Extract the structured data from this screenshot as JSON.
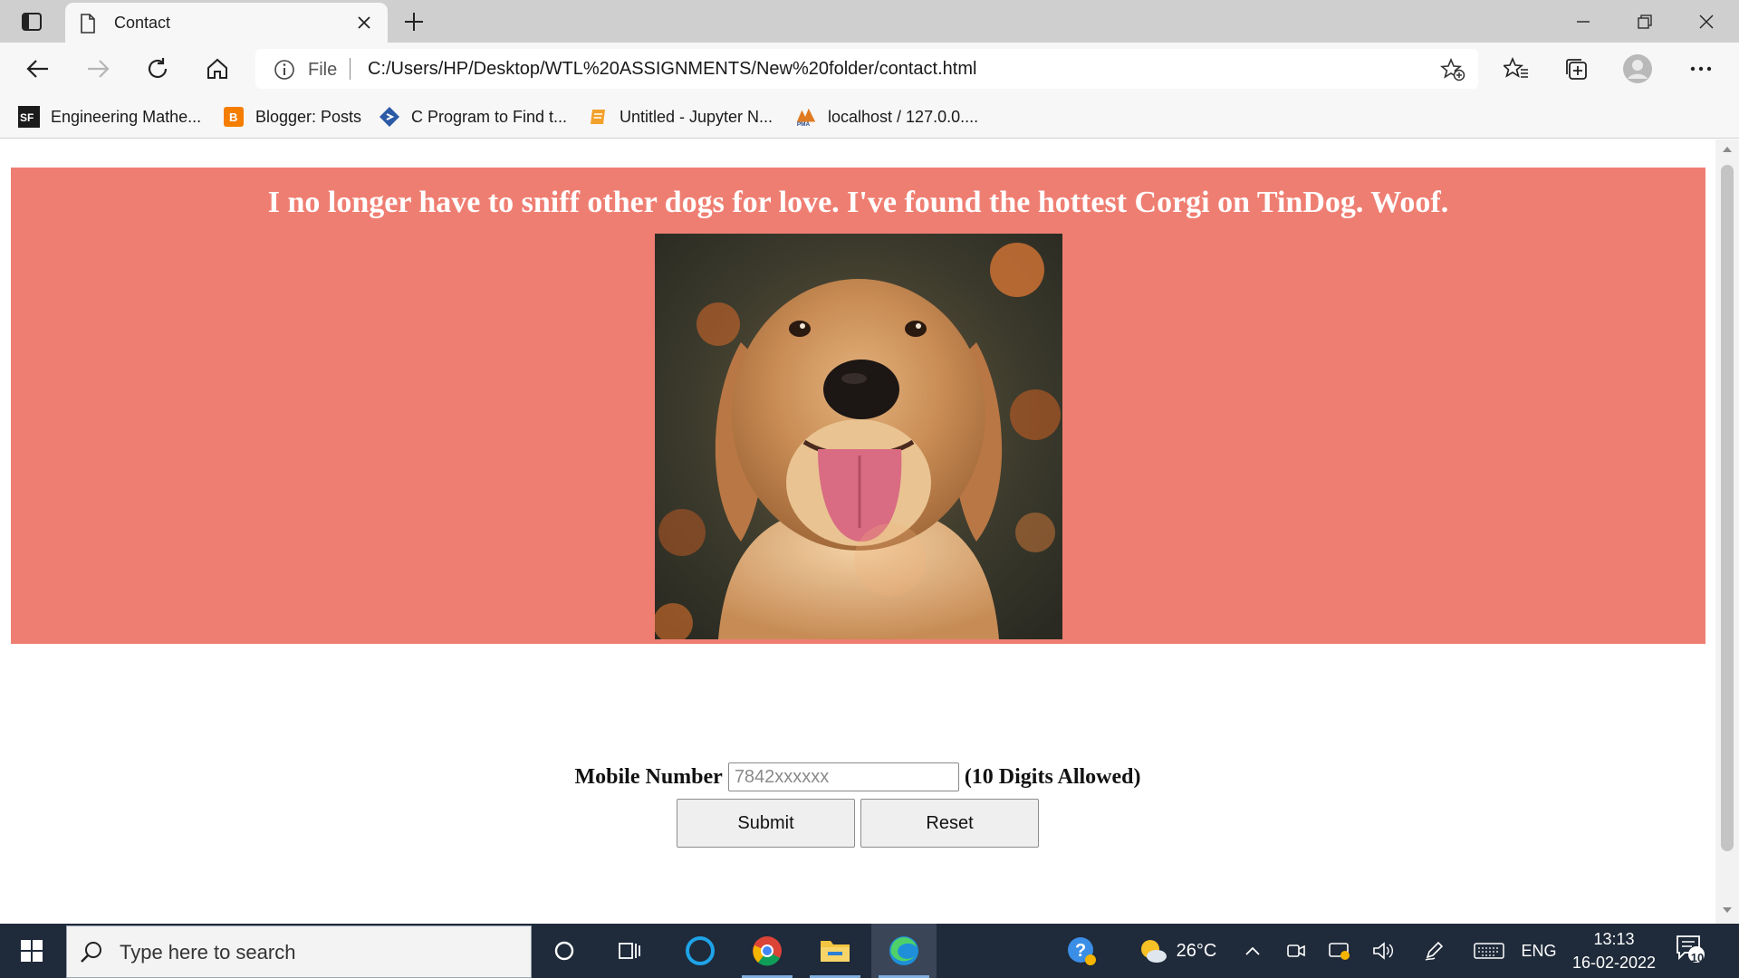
{
  "browser": {
    "tab_title": "Contact",
    "address_scheme": "File",
    "address_url": "C:/Users/HP/Desktop/WTL%20ASSIGNMENTS/New%20folder/contact.html",
    "bookmarks": [
      {
        "label": "Engineering Mathe...",
        "icon": "sf-icon"
      },
      {
        "label": "Blogger: Posts",
        "icon": "blogger-icon"
      },
      {
        "label": "C Program to Find t...",
        "icon": "c-program-icon"
      },
      {
        "label": "Untitled - Jupyter N...",
        "icon": "jupyter-icon"
      },
      {
        "label": "localhost / 127.0.0....",
        "icon": "phpmyadmin-icon"
      }
    ]
  },
  "page": {
    "headline": "I no longer have to sniff other dogs for love. I've found the hottest Corgi on TinDog. Woof.",
    "hero_color": "#ef7e72",
    "form": {
      "label": "Mobile Number",
      "placeholder": "7842xxxxxx",
      "hint": "(10 Digits Allowed)",
      "submit_label": "Submit",
      "reset_label": "Reset"
    }
  },
  "taskbar": {
    "search_placeholder": "Type here to search",
    "weather_temp": "26°C",
    "language": "ENG",
    "time": "13:13",
    "date": "16-02-2022",
    "notification_count": "10"
  }
}
